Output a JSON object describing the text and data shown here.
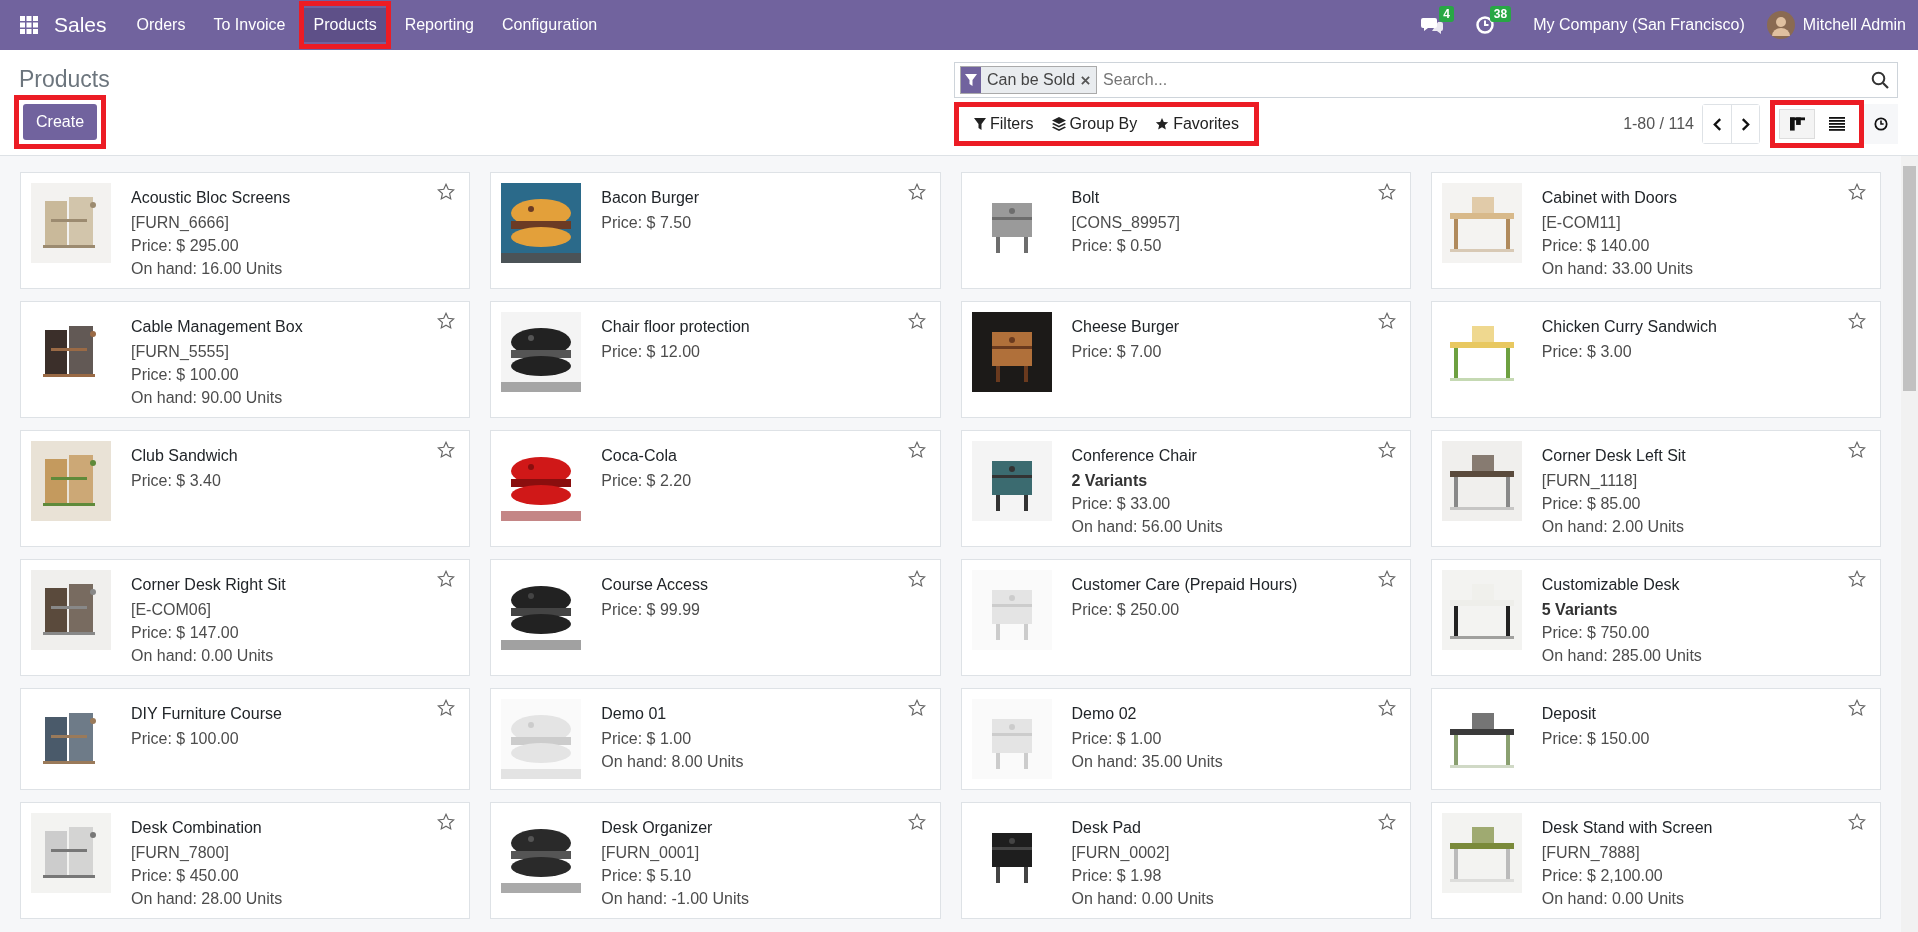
{
  "navbar": {
    "app_name": "Sales",
    "menu": [
      {
        "label": "Orders",
        "selected": false,
        "highlighted": false
      },
      {
        "label": "To Invoice",
        "selected": false,
        "highlighted": false
      },
      {
        "label": "Products",
        "selected": true,
        "highlighted": true
      },
      {
        "label": "Reporting",
        "selected": false,
        "highlighted": false
      },
      {
        "label": "Configuration",
        "selected": false,
        "highlighted": false
      }
    ],
    "messages_badge": "4",
    "activities_badge": "38",
    "company": "My Company (San Francisco)",
    "user": "Mitchell Admin"
  },
  "control_panel": {
    "title": "Products",
    "create_button": {
      "label": "Create",
      "highlighted": true
    },
    "search": {
      "facet": "Can be Sold",
      "placeholder": "Search..."
    },
    "search_options": {
      "highlighted": true,
      "buttons": [
        {
          "kind": "filter",
          "label": "Filters"
        },
        {
          "kind": "group",
          "label": "Group By"
        },
        {
          "kind": "favorite",
          "label": "Favorites"
        }
      ]
    },
    "pager": "1-80 / 114",
    "view_switcher": {
      "highlighted": true,
      "views": [
        {
          "kind": "kanban",
          "selected": true
        },
        {
          "kind": "list",
          "selected": false
        }
      ]
    }
  },
  "products": [
    {
      "name": "Acoustic Bloc Screens",
      "reference": "[FURN_6666]",
      "price": "Price: $ 295.00",
      "on_hand": "On hand: 16.00 Units",
      "favorite": false
    },
    {
      "name": "Bacon Burger",
      "price": "Price: $ 7.50",
      "favorite": false
    },
    {
      "name": "Bolt",
      "reference": "[CONS_89957]",
      "price": "Price: $ 0.50",
      "favorite": false
    },
    {
      "name": "Cabinet with Doors",
      "reference": "[E-COM11]",
      "price": "Price: $ 140.00",
      "on_hand": "On hand: 33.00 Units",
      "favorite": false
    },
    {
      "name": "Cable Management Box",
      "reference": "[FURN_5555]",
      "price": "Price: $ 100.00",
      "on_hand": "On hand: 90.00 Units",
      "favorite": false
    },
    {
      "name": "Chair floor protection",
      "price": "Price: $ 12.00",
      "favorite": false
    },
    {
      "name": "Cheese Burger",
      "price": "Price: $ 7.00",
      "favorite": false
    },
    {
      "name": "Chicken Curry Sandwich",
      "price": "Price: $ 3.00",
      "favorite": false
    },
    {
      "name": "Club Sandwich",
      "price": "Price: $ 3.40",
      "favorite": false
    },
    {
      "name": "Coca-Cola",
      "price": "Price: $ 2.20",
      "favorite": false
    },
    {
      "name": "Conference Chair",
      "variants": "2 Variants",
      "price": "Price: $ 33.00",
      "on_hand": "On hand: 56.00 Units",
      "favorite": false
    },
    {
      "name": "Corner Desk Left Sit",
      "reference": "[FURN_1118]",
      "price": "Price: $ 85.00",
      "on_hand": "On hand: 2.00 Units",
      "favorite": false
    },
    {
      "name": "Corner Desk Right Sit",
      "reference": "[E-COM06]",
      "price": "Price: $ 147.00",
      "on_hand": "On hand: 0.00 Units",
      "favorite": false
    },
    {
      "name": "Course Access",
      "price": "Price: $ 99.99",
      "favorite": false
    },
    {
      "name": "Customer Care (Prepaid Hours)",
      "price": "Price: $ 250.00",
      "favorite": false
    },
    {
      "name": "Customizable Desk",
      "variants": "5 Variants",
      "price": "Price: $ 750.00",
      "on_hand": "On hand: 285.00 Units",
      "favorite": false
    },
    {
      "name": "DIY Furniture Course",
      "price": "Price: $ 100.00",
      "favorite": false
    },
    {
      "name": "Demo 01",
      "price": "Price: $ 1.00",
      "on_hand": "On hand: 8.00 Units",
      "favorite": false
    },
    {
      "name": "Demo 02",
      "price": "Price: $ 1.00",
      "on_hand": "On hand: 35.00 Units",
      "favorite": false
    },
    {
      "name": "Deposit",
      "price": "Price: $ 150.00",
      "favorite": false
    },
    {
      "name": "Desk Combination",
      "reference": "[FURN_7800]",
      "price": "Price: $ 450.00",
      "on_hand": "On hand: 28.00 Units",
      "favorite": false
    },
    {
      "name": "Desk Organizer",
      "reference": "[FURN_0001]",
      "price": "Price: $ 5.10",
      "on_hand": "On hand: -1.00 Units",
      "favorite": false
    },
    {
      "name": "Desk Pad",
      "reference": "[FURN_0002]",
      "price": "Price: $ 1.98",
      "on_hand": "On hand: 0.00 Units",
      "favorite": false
    },
    {
      "name": "Desk Stand with Screen",
      "reference": "[FURN_7888]",
      "price": "Price: $ 2,100.00",
      "on_hand": "On hand: 0.00 Units",
      "favorite": false
    }
  ]
}
